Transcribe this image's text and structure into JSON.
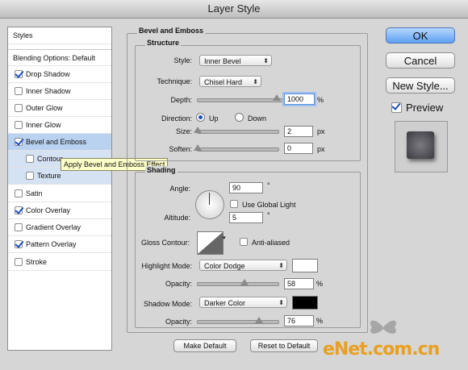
{
  "window": {
    "title": "Layer Style"
  },
  "left_panel": {
    "styles_header": "Styles",
    "blending_options": "Blending Options: Default",
    "items": [
      {
        "label": "Drop Shadow",
        "checked": true
      },
      {
        "label": "Inner Shadow",
        "checked": false
      },
      {
        "label": "Outer Glow",
        "checked": false
      },
      {
        "label": "Inner Glow",
        "checked": false
      },
      {
        "label": "Bevel and Emboss",
        "checked": true
      },
      {
        "label": "Contour",
        "checked": false
      },
      {
        "label": "Texture",
        "checked": false
      },
      {
        "label": "Satin",
        "checked": false
      },
      {
        "label": "Color Overlay",
        "checked": true
      },
      {
        "label": "Gradient Overlay",
        "checked": false
      },
      {
        "label": "Pattern Overlay",
        "checked": true
      },
      {
        "label": "Stroke",
        "checked": false
      }
    ]
  },
  "tooltip": "Apply Bevel and Emboss Effect",
  "bevel": {
    "section_title": "Bevel and Emboss",
    "structure_title": "Structure",
    "style_label": "Style:",
    "style_value": "Inner Bevel",
    "technique_label": "Technique:",
    "technique_value": "Chisel Hard",
    "depth_label": "Depth:",
    "depth_value": "1000",
    "depth_unit": "%",
    "direction_label": "Direction:",
    "direction_up": "Up",
    "direction_down": "Down",
    "size_label": "Size:",
    "size_value": "2",
    "size_unit": "px",
    "soften_label": "Soften:",
    "soften_value": "0",
    "soften_unit": "px"
  },
  "shading": {
    "title": "Shading",
    "angle_label": "Angle:",
    "angle_value": "90",
    "angle_unit": "°",
    "global_light_label": "Use Global Light",
    "altitude_label": "Altitude:",
    "altitude_value": "5",
    "altitude_unit": "°",
    "gloss_label": "Gloss Contour:",
    "anti_aliased_label": "Anti-aliased",
    "highlight_label": "Highlight Mode:",
    "highlight_value": "Color Dodge",
    "highlight_color": "#ffffff",
    "opacity_label": "Opacity:",
    "highlight_opacity": "58",
    "opacity_unit": "%",
    "shadow_label": "Shadow Mode:",
    "shadow_value": "Darker Color",
    "shadow_color": "#000000",
    "shadow_opacity_label": "Opacity:",
    "shadow_opacity": "76",
    "shadow_opacity_unit": "%"
  },
  "footer": {
    "make_default": "Make Default",
    "reset_default": "Reset to Default"
  },
  "right": {
    "ok": "OK",
    "cancel": "Cancel",
    "new_style": "New Style...",
    "preview": "Preview"
  },
  "watermark": "eNet.com.cn"
}
